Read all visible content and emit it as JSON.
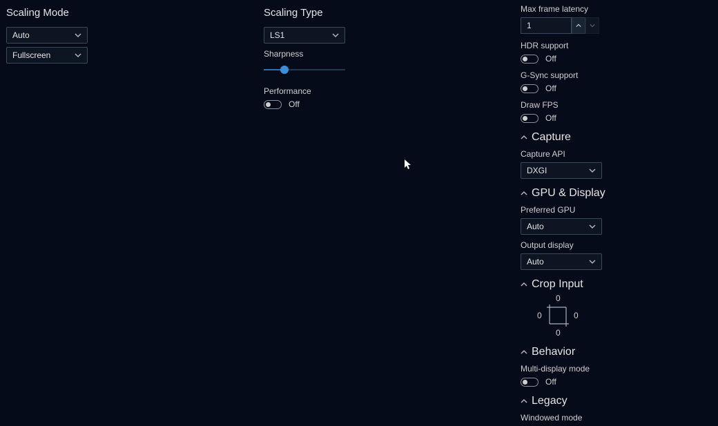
{
  "col1": {
    "heading": "Scaling Mode",
    "dropdown1": "Auto",
    "dropdown2": "Fullscreen"
  },
  "col2": {
    "heading": "Scaling Type",
    "dropdown": "LS1",
    "sharpness_label": "Sharpness",
    "performance_label": "Performance",
    "performance_state": "Off"
  },
  "col3": {
    "max_frame_latency_label": "Max frame latency",
    "max_frame_latency_value": "1",
    "hdr_label": "HDR support",
    "hdr_state": "Off",
    "gsync_label": "G-Sync support",
    "gsync_state": "Off",
    "drawfps_label": "Draw FPS",
    "drawfps_state": "Off",
    "capture_section": "Capture",
    "capture_api_label": "Capture API",
    "capture_api_value": "DXGI",
    "gpu_section": "GPU & Display",
    "pref_gpu_label": "Preferred GPU",
    "pref_gpu_value": "Auto",
    "output_display_label": "Output display",
    "output_display_value": "Auto",
    "crop_section": "Crop Input",
    "crop": {
      "top": "0",
      "left": "0",
      "right": "0",
      "bottom": "0"
    },
    "behavior_section": "Behavior",
    "multi_display_label": "Multi-display mode",
    "multi_display_state": "Off",
    "legacy_section": "Legacy",
    "windowed_label": "Windowed mode"
  }
}
